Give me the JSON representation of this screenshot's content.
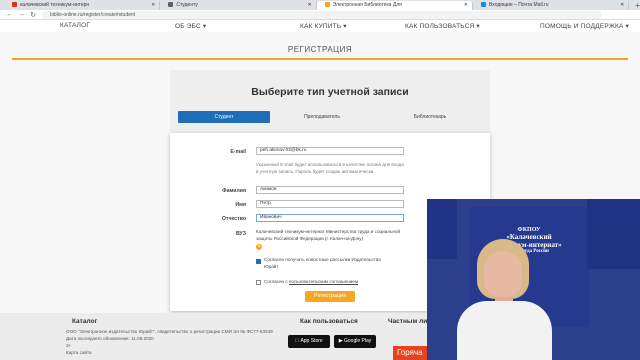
{
  "browser": {
    "tabs": [
      {
        "label": "калачевский техникум-интерн",
        "color": "#d93025",
        "active": false
      },
      {
        "label": "Студенту",
        "color": "#5f6368",
        "active": false
      },
      {
        "label": "Электронная Библиотека Для",
        "color": "#f5a623",
        "active": true
      },
      {
        "label": "Входящие – Почта Mail.ru",
        "color": "#168de2",
        "active": false
      }
    ],
    "new_tab": "+",
    "url": "biblio-online.ru/register/create#student"
  },
  "nav": {
    "items": [
      "КАТАЛОГ",
      "ОБ ЭБС ▾",
      "КАК КУПИТЬ ▾",
      "КАК ПОЛЬЗОВАТЬСЯ ▾",
      "ПОМОЩЬ И ПОДДЕРЖКА ▾"
    ]
  },
  "page": {
    "title": "РЕГИСТРАЦИЯ",
    "account_type_title": "Выберите тип учетной записи",
    "types": [
      "Студент",
      "Преподаватель",
      "Библиотекарь"
    ]
  },
  "form": {
    "email_label": "E-mail",
    "email_value": "peh.akimov.03@bk.ru",
    "email_hint": "Указанный E-mail будет использоваться в качестве логина для входа в учетную запись. Пароль будет создан автоматически.",
    "lastname_label": "Фамилия",
    "lastname_value": "Акимов",
    "firstname_label": "Имя",
    "firstname_value": "Петр",
    "patronymic_label": "Отчество",
    "patronymic_value": "Иванович",
    "vuz_label": "ВУЗ",
    "vuz_value": "Калачевский техникум-интернат Министерства труда и социальной защиты Российской Федерации (г. Калач-на-Дону)",
    "help_icon": "?",
    "newsletter_label": "Согласен получать новостные рассылки Издательства Юрайт",
    "newsletter_checked": true,
    "agree_prefix": "Согласен с ",
    "agree_link": "пользовательским соглашением",
    "agree_checked": false,
    "submit_label": "Регистрация"
  },
  "footer": {
    "catalog_title": "Каталог",
    "how_to_use_title": "Как пользоваться",
    "private_title": "Частным ли",
    "copyright": "ООО \"Электронное издательство Юрайт\", свидетельство о регистрации СМИ Эл № ФС77-53349",
    "last_update": "Дата последнего обновления: 11.09.2020",
    "short": "3+",
    "sitemap": "Карта сайта",
    "app_store": "App Store",
    "google_play": "Google Play",
    "hot_label": "Горяча"
  },
  "webcam": {
    "banner_text": [
      "ФКПОУ",
      "«Калачевский",
      "техникум-интернат»",
      "Минтруда России"
    ]
  }
}
